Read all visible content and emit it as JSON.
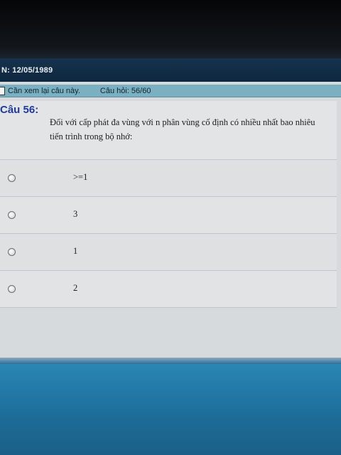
{
  "header": {
    "birthdate_text": "N: 12/05/1989"
  },
  "status_bar": {
    "review_label": "Cần xem lại câu này.",
    "progress_label": "Câu hỏi: 56/60"
  },
  "question": {
    "number_label": "Câu 56:",
    "text": "Đối với cấp phát đa vùng với n phân vùng cố định có nhiều nhất bao nhiêu tiến trình trong bộ nhớ:"
  },
  "options": [
    {
      "label": ">=1"
    },
    {
      "label": "3"
    },
    {
      "label": "1"
    },
    {
      "label": "2"
    }
  ],
  "colors": {
    "title_bar": "#16324c",
    "status_bar": "#7bb0c0",
    "question_number": "#1e3a9e",
    "content_bg": "#e1e2e4"
  }
}
